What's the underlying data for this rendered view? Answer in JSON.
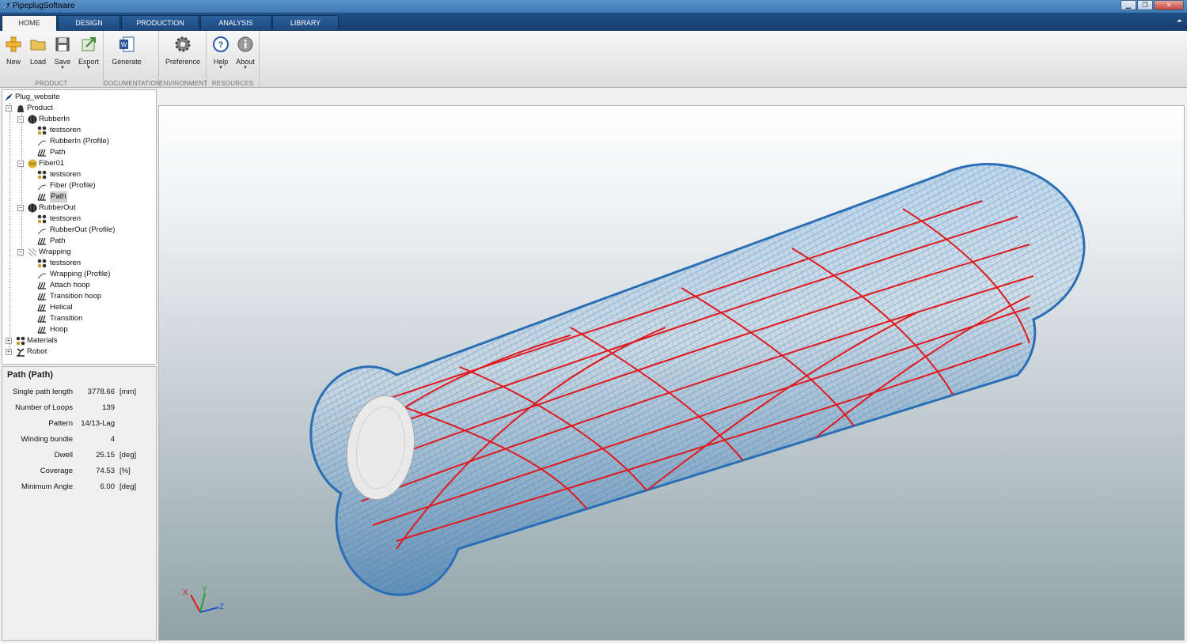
{
  "window": {
    "title": "PipeplugSoftware",
    "close_glyph": "✕",
    "minimize_glyph": "▁",
    "maximize_glyph": "❐"
  },
  "tabs": [
    {
      "label": "HOME",
      "active": true
    },
    {
      "label": "DESIGN",
      "active": false
    },
    {
      "label": "PRODUCTION",
      "active": false
    },
    {
      "label": "ANALYSIS",
      "active": false
    },
    {
      "label": "LIBRARY",
      "active": false
    }
  ],
  "ribbon": {
    "groups": {
      "product": "PRODUCT",
      "documentation": "DOCUMENTATION",
      "environment": "ENVIRONMENT",
      "resources": "RESOURCES"
    },
    "buttons": {
      "new": "New",
      "load": "Load",
      "save": "Save",
      "export": "Export",
      "generate": "Generate",
      "preference": "Preference",
      "help": "Help",
      "about": "About"
    },
    "dropdown_glyph": "▼",
    "collapse_glyph": "⏶"
  },
  "tree": {
    "root": "Plug_website",
    "product": "Product",
    "rubber_in": "RubberIn",
    "rubber_in_children": [
      "testsoren",
      "RubberIn (Profile)",
      "Path"
    ],
    "fiber": "Fiber01",
    "fiber_children": [
      "testsoren",
      "Fiber (Profile)",
      "Path"
    ],
    "rubber_out": "RubberOut",
    "rubber_out_children": [
      "testsoren",
      "RubberOut (Profile)",
      "Path"
    ],
    "wrapping": "Wrapping",
    "wrapping_children": [
      "testsoren",
      "Wrapping (Profile)",
      "Attach hoop",
      "Transition hoop",
      "Helical",
      "Transition",
      "Hoop"
    ],
    "materials": "Materials",
    "robot": "Robot",
    "minus": "−",
    "plus": "+"
  },
  "properties": {
    "title": "Path (Path)",
    "rows": [
      {
        "label": "Single path length",
        "value": "3778.66",
        "unit": "[mm]"
      },
      {
        "label": "Number of Loops",
        "value": "139",
        "unit": ""
      },
      {
        "label": "Pattern",
        "value": "14/13-Lag",
        "unit": ""
      },
      {
        "label": "Winding bundle",
        "value": "4",
        "unit": ""
      },
      {
        "label": "Dwell",
        "value": "25.15",
        "unit": "[deg]"
      },
      {
        "label": "Coverage",
        "value": "74.53",
        "unit": "[%]"
      },
      {
        "label": "Minimum Angle",
        "value": "6.00",
        "unit": "[deg]"
      }
    ]
  },
  "axes": {
    "x": "X",
    "y": "Y",
    "z": "Z"
  },
  "colors": {
    "mesh_blue": "#2f7fc6",
    "path_red": "#e0191f",
    "end_cap": "#e9e9e9",
    "ribbon_header": "#1f4f88"
  }
}
